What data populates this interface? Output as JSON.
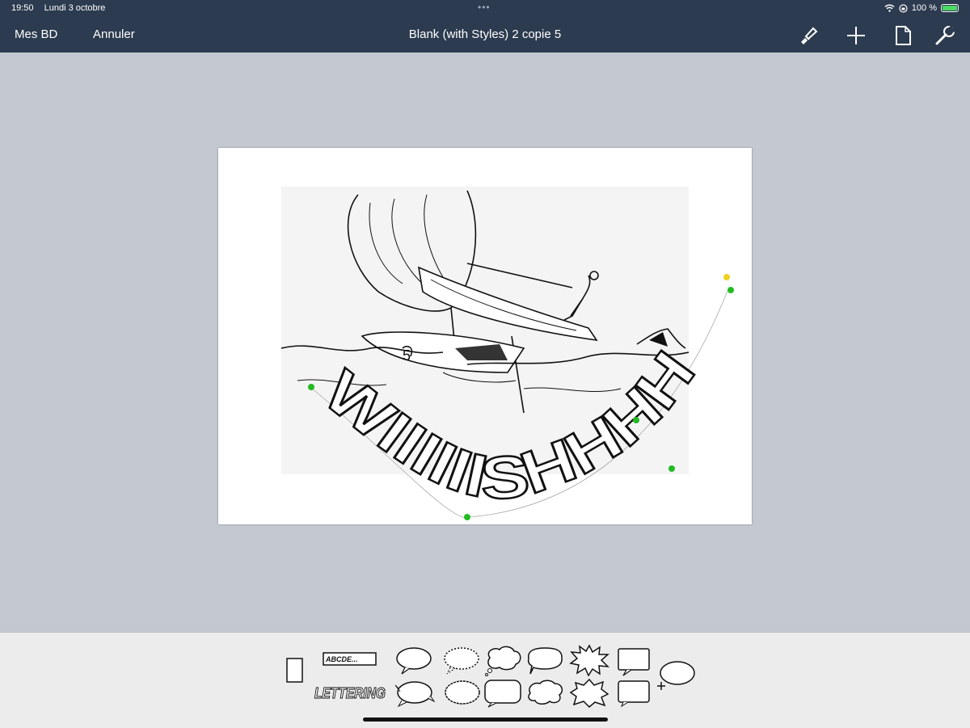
{
  "status": {
    "time": "19:50",
    "date": "Lundi 3 octobre",
    "battery": "100 %"
  },
  "nav": {
    "back_label": "Mes BD",
    "cancel_label": "Annuler",
    "title": "Blank (with Styles) 2 copie 5"
  },
  "toolbar": {
    "icons": [
      "brush-icon",
      "plus-icon",
      "page-icon",
      "wrench-icon"
    ]
  },
  "artwork": {
    "sfx_text": "WIIIIIISHHHH"
  },
  "palette": {
    "caption_text": "ABCDE...",
    "lettering_text": "LETTERING",
    "items": [
      "panel",
      "caption-box",
      "lettering",
      "speech-bubble",
      "dashed-bubble",
      "thought-bubble",
      "rounded-bubble",
      "burst-bubble",
      "square-bubble",
      "add-bubble"
    ]
  },
  "colors": {
    "navbar": "#2c3b4f",
    "background": "#c4c9d1",
    "palette": "#ececec",
    "handle_green": "#22bb22",
    "handle_yellow": "#f0d020"
  }
}
